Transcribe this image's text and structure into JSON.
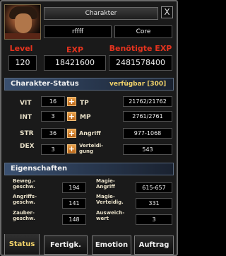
{
  "header": {
    "title": "Charakter",
    "name": "rffff",
    "clan": "Core",
    "close": "X"
  },
  "stats_top": {
    "level_label": "Level",
    "level": "120",
    "exp_label": "EXP",
    "exp": "18421600",
    "needed_label": "Benötigte EXP",
    "needed": "2481578400"
  },
  "status": {
    "title": "Charakter-Status",
    "available": "verfügbar [300]",
    "attrs": [
      {
        "label": "VIT",
        "value": "16"
      },
      {
        "label": "INT",
        "value": "3"
      },
      {
        "label": "STR",
        "value": "36"
      },
      {
        "label": "DEX",
        "value": "3"
      }
    ],
    "tp_label": "TP",
    "tp": "21762/21762",
    "mp_label": "MP",
    "mp": "2761/2761",
    "attack_label": "Angriff",
    "attack": "977-1068",
    "defense_label": "Verteidi-\ngung",
    "defense": "543"
  },
  "properties": {
    "title": "Eigenschaften",
    "move_speed_label": "Beweg.-\ngeschw.",
    "move_speed": "194",
    "attack_speed_label": "Angriffs-\ngeschw.",
    "attack_speed": "141",
    "cast_speed_label": "Zauber-\ngeschw.",
    "cast_speed": "148",
    "magic_attack_label": "Magie-\nAngriff",
    "magic_attack": "615-657",
    "magic_defense_label": "Magie-\nVerteidig.",
    "magic_defense": "331",
    "evasion_label": "Ausweich-\nwert",
    "evasion": "3"
  },
  "tabs": [
    "Status",
    "Fertigk.",
    "Emotion",
    "Auftrag"
  ],
  "colors": {
    "label_red": "#e5331e",
    "accent_gold": "#f2d36a",
    "section_blue": "#2a3a52"
  }
}
